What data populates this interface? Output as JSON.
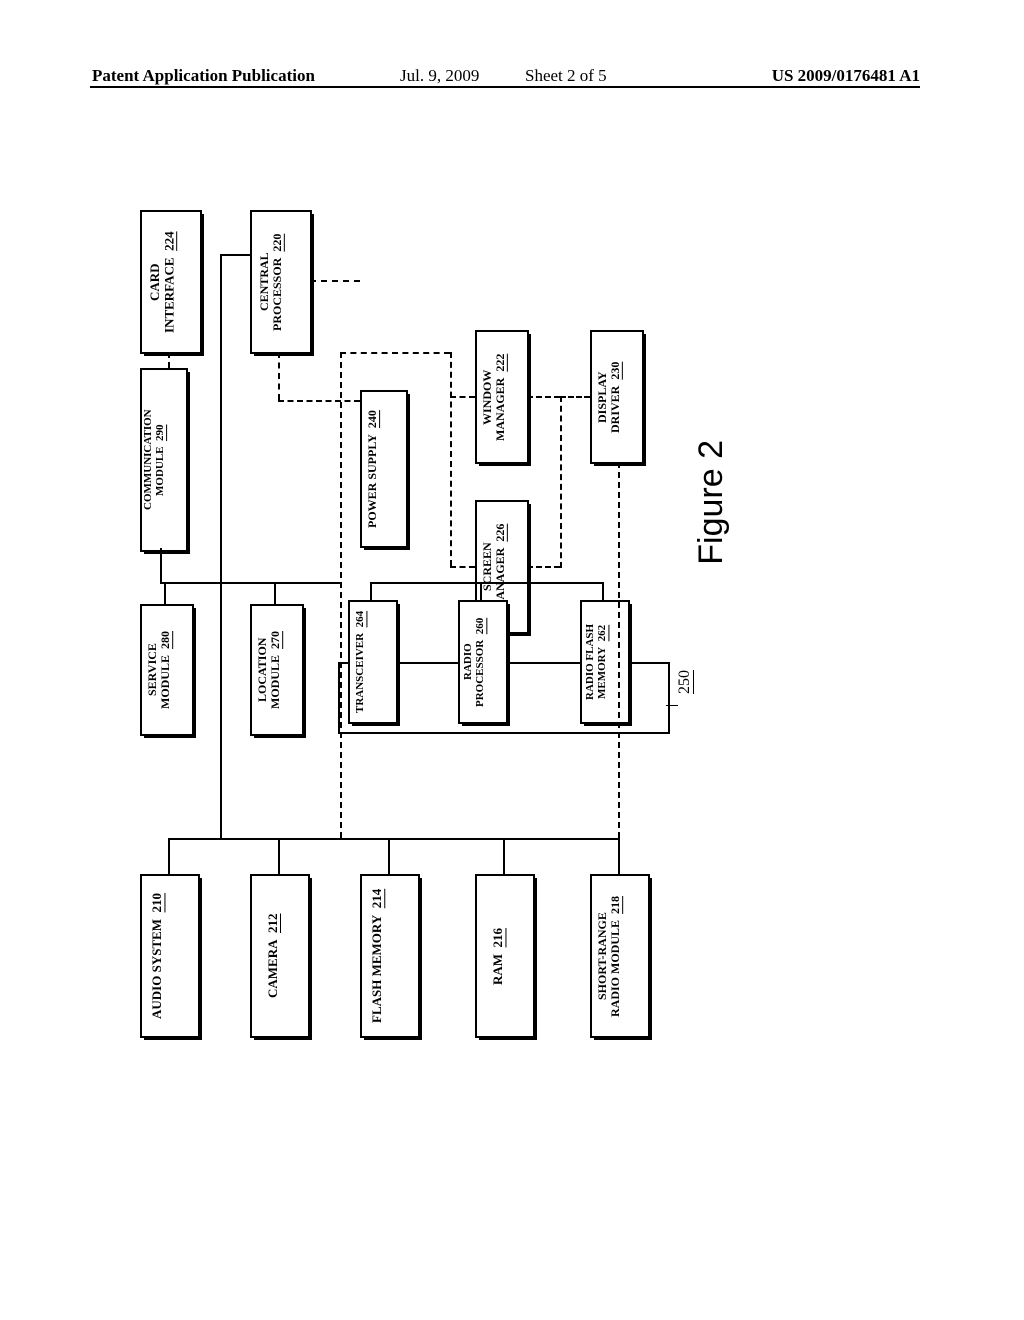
{
  "header": {
    "publication": "Patent Application Publication",
    "date": "Jul. 9, 2009",
    "sheet": "Sheet 2 of 5",
    "number": "US 2009/0176481 A1"
  },
  "figure_label": "Figure 2",
  "radio_group_ref": "250",
  "blocks": {
    "audio": {
      "name": "AUDIO SYSTEM",
      "ref": "210"
    },
    "camera": {
      "name": "CAMERA",
      "ref": "212"
    },
    "flashmem": {
      "name": "FLASH MEMORY",
      "ref": "214"
    },
    "ram": {
      "name": "RAM",
      "ref": "216"
    },
    "srradio": {
      "name": "SHORT-RANGE\nRADIO MODULE",
      "ref": "218"
    },
    "card": {
      "name": "CARD\nINTERFACE",
      "ref": "224"
    },
    "cpu": {
      "name": "CENTRAL\nPROCESSOR",
      "ref": "220"
    },
    "winmgr": {
      "name": "WINDOW\nMANAGER",
      "ref": "222"
    },
    "scrmgr": {
      "name": "SCREEN\nMANAGER",
      "ref": "226"
    },
    "dispdrv": {
      "name": "DISPLAY\nDRIVER",
      "ref": "230"
    },
    "power": {
      "name": "POWER SUPPLY",
      "ref": "240"
    },
    "comm": {
      "name": "COMMUNICATION\nMODULE",
      "ref": "290"
    },
    "service": {
      "name": "SERVICE\nMODULE",
      "ref": "280"
    },
    "location": {
      "name": "LOCATION\nMODULE",
      "ref": "270"
    },
    "transceiver": {
      "name": "TRANSCEIVER",
      "ref": "264"
    },
    "radioproc": {
      "name": "RADIO\nPROCESSOR",
      "ref": "260"
    },
    "radioflash": {
      "name": "RADIO FLASH\nMEMORY",
      "ref": "262"
    }
  }
}
